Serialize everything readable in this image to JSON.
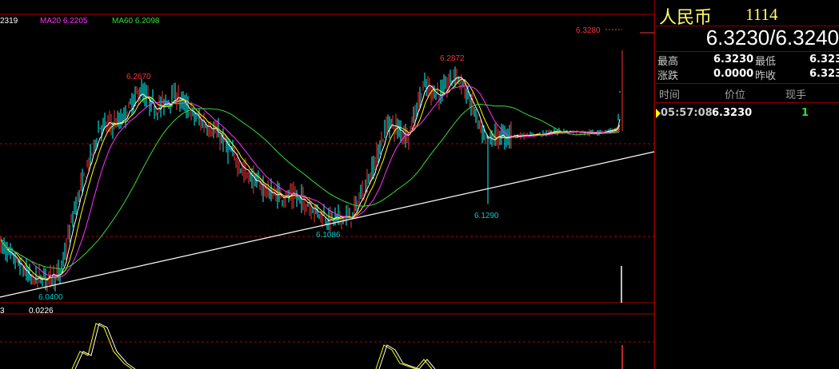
{
  "chart_data": {
    "type": "candlestick",
    "legend": [
      {
        "name": "",
        "value": "2319",
        "color": "#ffffff"
      },
      {
        "name": "MA20",
        "value": "6.2205",
        "color": "#ff33ff"
      },
      {
        "name": "MA60",
        "value": "6.2098",
        "color": "#33dd33"
      }
    ],
    "annotations": [
      {
        "label": "6.0400",
        "price": 6.04,
        "color": "#00cccc"
      },
      {
        "label": "6.2670",
        "price": 6.267,
        "color": "#ff3333"
      },
      {
        "label": "6.1086",
        "price": 6.1086,
        "color": "#00cccc"
      },
      {
        "label": "6.2872",
        "price": 6.2872,
        "color": "#ff3333"
      },
      {
        "label": "6.1290",
        "price": 6.129,
        "color": "#00cccc"
      },
      {
        "label": "6.3280",
        "price": 6.328,
        "color": "#ff3333"
      }
    ],
    "ylim": [
      6.02,
      6.34
    ],
    "indicator": {
      "label_left": "3",
      "value": "0.0226"
    },
    "trendline": true
  },
  "panel": {
    "name": "人民币",
    "code": "1114",
    "price_pair": "6.3230/6.3240",
    "high_label": "最高",
    "high_value": "6.3230",
    "low_label": "最低",
    "low_value": "6.323",
    "change_label": "涨跌",
    "change_value": "0.0000",
    "prev_label": "昨收",
    "prev_value": "6.323",
    "headers": {
      "time": "时间",
      "price": "价位",
      "volume": "现手"
    },
    "tick": {
      "time": "05:57:08",
      "price": "6.3230",
      "volume": "1"
    }
  },
  "colors": {
    "up": "#ff3333",
    "down": "#00ffff",
    "ma5": "#ffffff",
    "ma10": "#ffff00",
    "ma20": "#ff33ff",
    "ma60": "#33dd33",
    "grid": "#aa0000"
  }
}
